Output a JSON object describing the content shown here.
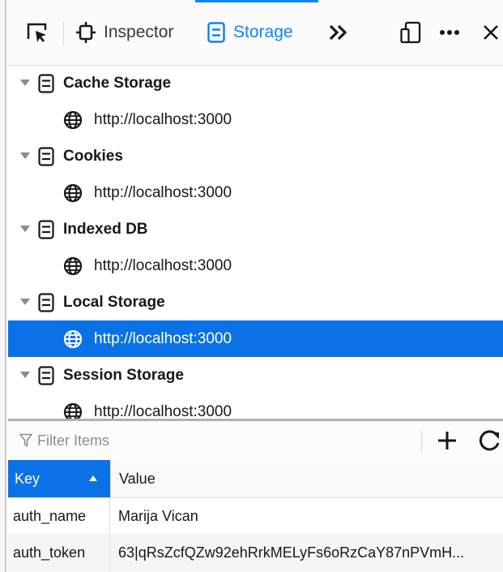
{
  "toolbar": {
    "inspector_label": "Inspector",
    "storage_label": "Storage",
    "accent_color": "#0a84ff"
  },
  "tree": [
    {
      "category": "Cache Storage",
      "host": "http://localhost:3000",
      "selected": false
    },
    {
      "category": "Cookies",
      "host": "http://localhost:3000",
      "selected": false
    },
    {
      "category": "Indexed DB",
      "host": "http://localhost:3000",
      "selected": false
    },
    {
      "category": "Local Storage",
      "host": "http://localhost:3000",
      "selected": true
    },
    {
      "category": "Session Storage",
      "host": "http://localhost:3000",
      "selected": false
    }
  ],
  "filter": {
    "placeholder": "Filter Items",
    "value": ""
  },
  "table": {
    "columns": {
      "key": "Key",
      "value": "Value"
    },
    "sorted_by": "Key",
    "rows": [
      {
        "key": "auth_name",
        "value": "Marija Vican"
      },
      {
        "key": "auth_token",
        "value": "63|qRsZcfQZw92ehRrkMELyFs6oRzCaY87nPVmH..."
      }
    ]
  },
  "colors": {
    "selection": "#0a72e6",
    "icon": "#18181a"
  }
}
